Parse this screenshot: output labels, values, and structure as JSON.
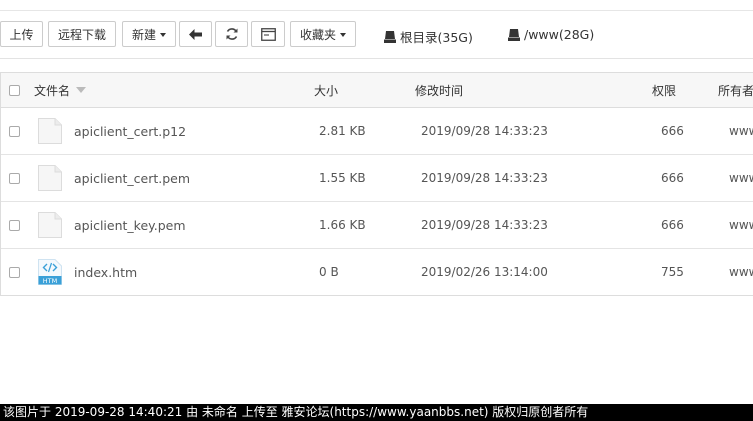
{
  "toolbar": {
    "upload": "上传",
    "remote_download": "远程下载",
    "new": "新建",
    "favorites": "收藏夹"
  },
  "disks": [
    {
      "label": "根目录(35G)"
    },
    {
      "label": "/www(28G)"
    }
  ],
  "table": {
    "headers": {
      "name": "文件名",
      "size": "大小",
      "modified": "修改时间",
      "permission": "权限",
      "owner": "所有者"
    },
    "rows": [
      {
        "name": "apiclient_cert.p12",
        "size": "2.81 KB",
        "modified": "2019/09/28 14:33:23",
        "permission": "666",
        "owner": "www",
        "icon": "file-icon"
      },
      {
        "name": "apiclient_cert.pem",
        "size": "1.55 KB",
        "modified": "2019/09/28 14:33:23",
        "permission": "666",
        "owner": "www",
        "icon": "file-icon"
      },
      {
        "name": "apiclient_key.pem",
        "size": "1.66 KB",
        "modified": "2019/09/28 14:33:23",
        "permission": "666",
        "owner": "www",
        "icon": "file-icon"
      },
      {
        "name": "index.htm",
        "size": "0 B",
        "modified": "2019/02/26 13:14:00",
        "permission": "755",
        "owner": "www",
        "icon": "htm-file-icon",
        "icon_text": "HTM"
      }
    ]
  },
  "footer": {
    "text": "该图片于 2019-09-28 14:40:21 由 未命名 上传至 雅安论坛(https://www.yaanbbs.net) 版权归原创者所有"
  },
  "colors": {
    "htm_icon": "#3aa0d8",
    "footer_bg": "#000000",
    "header_bg": "#f7f7f7"
  }
}
